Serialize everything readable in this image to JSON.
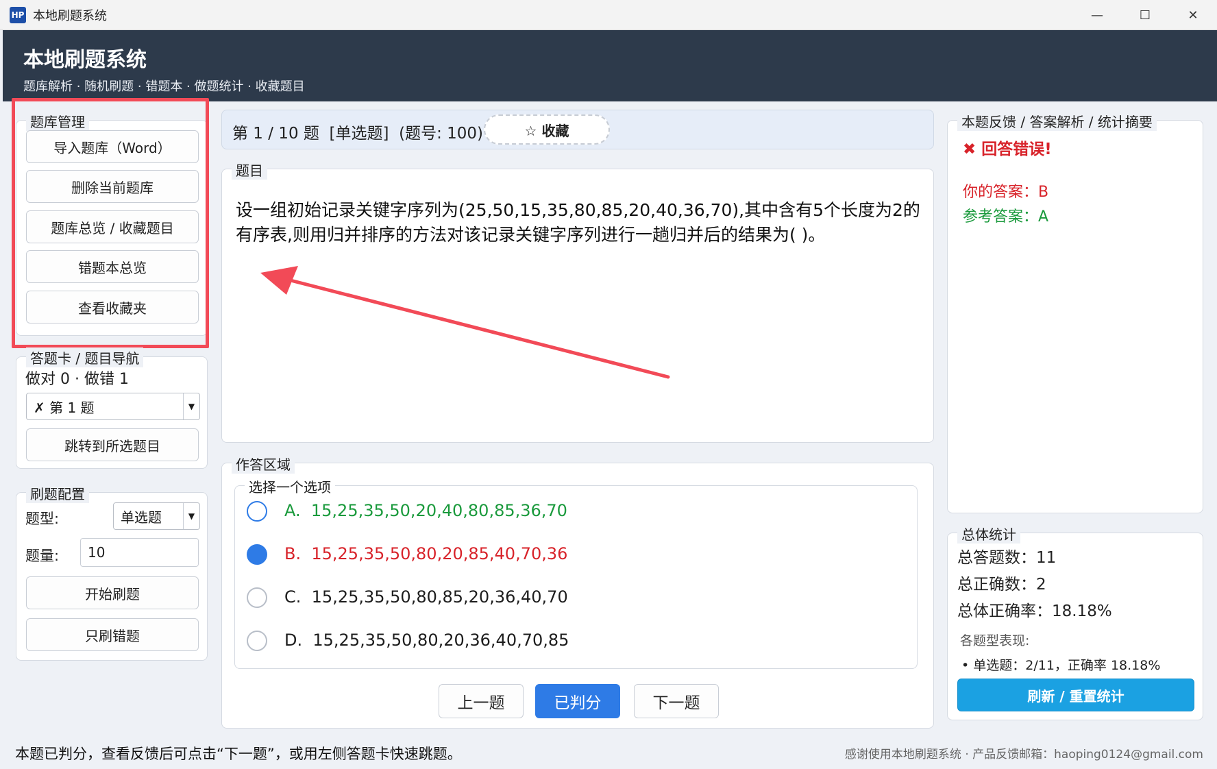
{
  "window": {
    "icon_text": "HP",
    "title": "本地刷题系统",
    "minimize": "—",
    "maximize": "☐",
    "close": "✕"
  },
  "header": {
    "title": "本地刷题系统",
    "subtitle": "题库解析 · 随机刷题 · 错题本 · 做题统计 · 收藏题目"
  },
  "bank_management": {
    "title": "题库管理",
    "buttons": [
      "导入题库（Word）",
      "删除当前题库",
      "题库总览 / 收藏题目",
      "错题本总览",
      "查看收藏夹"
    ]
  },
  "answer_card": {
    "title": "答题卡 / 题目导航",
    "summary": "做对 0 · 做错 1",
    "selected": "✗ 第 1 题",
    "jump_button": "跳转到所选题目"
  },
  "config": {
    "title": "刷题配置",
    "type_label": "题型:",
    "type_value": "单选题",
    "count_label": "题量:",
    "count_value": "10",
    "start_button": "开始刷题",
    "wrong_only_button": "只刷错题"
  },
  "question_bar": {
    "progress": "第 1 / 10 题",
    "type": "[单选题]",
    "number": "(题号: 100)",
    "favorite_button": "☆ 收藏"
  },
  "question": {
    "title": "题目",
    "text": "设一组初始记录关键字序列为(25,50,15,35,80,85,20,40,36,70),其中含有5个长度为2的有序表,则用归并排序的方法对该记录关键字序列进行一趟归并后的结果为( )。"
  },
  "answer_area": {
    "title": "作答区域",
    "choose_title": "选择一个选项",
    "options": [
      {
        "letter": "A.",
        "text": "15,25,35,50,20,40,80,85,36,70"
      },
      {
        "letter": "B.",
        "text": "15,25,35,50,80,20,85,40,70,36"
      },
      {
        "letter": "C.",
        "text": "15,25,35,50,80,85,20,36,40,70"
      },
      {
        "letter": "D.",
        "text": "15,25,35,50,80,20,36,40,70,85"
      }
    ],
    "prev_button": "上一题",
    "judged_button": "已判分",
    "next_button": "下一题"
  },
  "feedback": {
    "title": "本题反馈 / 答案解析 / 统计摘要",
    "result_icon": "✖",
    "result": "回答错误!",
    "your_answer": "你的答案：B",
    "reference_answer": "参考答案：A"
  },
  "stats": {
    "title": "总体统计",
    "total": "总答题数：11",
    "correct": "总正确数：2",
    "rate": "总体正确率：18.18%",
    "by_type_title": "各题型表现:",
    "by_type_item": "• 单选题：2/11，正确率 18.18%",
    "refresh_button": "刷新 / 重置统计"
  },
  "status": {
    "left": "本题已判分，查看反馈后可点击“下一题”，或用左侧答题卡快速跳题。",
    "right": "感谢使用本地刷题系统 · 产品反馈邮箱：haoping0124@gmail.com"
  },
  "colors": {
    "header_bg": "#2d3a4b",
    "accent_blue": "#2e7be6",
    "correct_green": "#1a9a3c",
    "wrong_red": "#d8232a",
    "annotation_red": "#f24a57",
    "refresh_bg": "#1ba1e2"
  }
}
